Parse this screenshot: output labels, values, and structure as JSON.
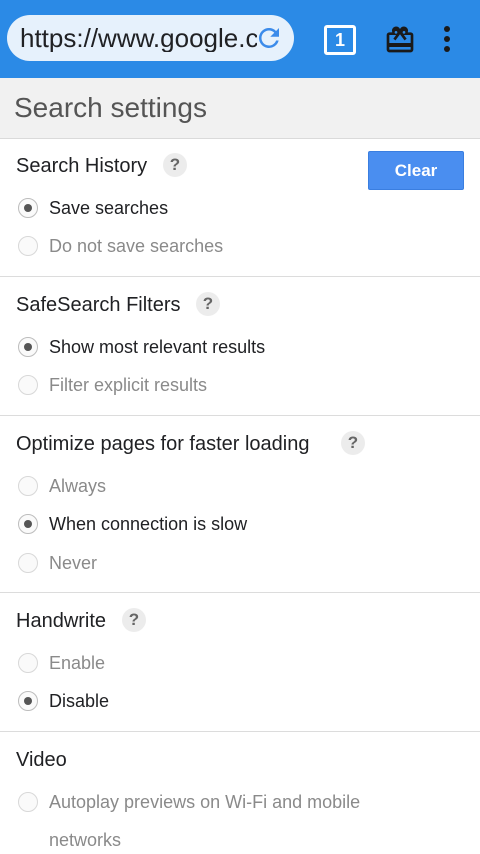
{
  "browser": {
    "url": "https://www.google.com",
    "tab_count": "1",
    "icons": [
      "reload-icon",
      "tabs-icon",
      "gift-icon",
      "more-vert-icon"
    ]
  },
  "header": {
    "title": "Search settings"
  },
  "search_history": {
    "title": "Search History",
    "help": "?",
    "clear_label": "Clear",
    "options": [
      "Save searches",
      "Do not save searches"
    ],
    "selected": 0
  },
  "safesearch": {
    "title": "SafeSearch Filters",
    "help": "?",
    "options": [
      "Show most relevant results",
      "Filter explicit results"
    ],
    "selected": 0
  },
  "optimize": {
    "title": "Optimize pages for faster loading",
    "help": "?",
    "options": [
      "Always",
      "When connection is slow",
      "Never"
    ],
    "selected": 1
  },
  "handwrite": {
    "title": "Handwrite",
    "help": "?",
    "options": [
      "Enable",
      "Disable"
    ],
    "selected": 1
  },
  "video": {
    "title": "Video",
    "options": [
      "Autoplay previews on Wi-Fi and mobile",
      "networks"
    ]
  },
  "colors": {
    "toolbar": "#2b8ae6",
    "button": "#4a8ef0"
  }
}
